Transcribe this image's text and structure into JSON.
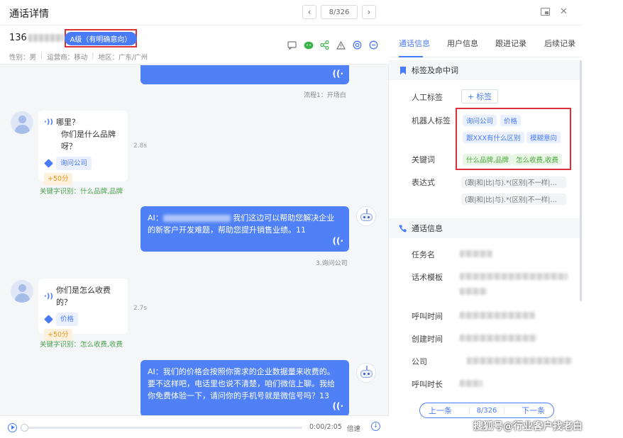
{
  "window": {
    "title": "通话详情",
    "page_indicator": "8/326",
    "prev_icon": "chevron-left-icon",
    "next_icon": "chevron-right-icon"
  },
  "caller": {
    "phone_prefix": "136",
    "level_badge": "A级（有明确意向）",
    "gender": "性别：男",
    "carrier": "运营商：移动",
    "region": "地区：广东/广州"
  },
  "chat": {
    "ai_msg_1": {
      "node": "流程1：开场白"
    },
    "user_msg_1": {
      "text1": "哪里？",
      "text2": "你们是什么品牌呀？",
      "tag": "询问公司",
      "score": "+50分",
      "duration": "2.8s",
      "keyword_hit": "关键字识别：什么品牌,品牌"
    },
    "ai_msg_2": {
      "prefix": "AI：",
      "text": "我们这边可以帮助您解决企业的新客户开发难题，帮助您提升销售业绩。11",
      "node": "3.询问公司"
    },
    "user_msg_2": {
      "text1": "你们是怎么收费的？",
      "tag": "价格",
      "score": "+50分",
      "duration": "2.7s",
      "keyword_hit": "关键字识别：怎么收费,收费"
    },
    "ai_msg_3": {
      "text": "AI：我们的价格会按照你需求的企业数据量来收费的。要不这样吧，电话里也说不清楚，咱们微信上聊。我给你免费体验一下，请问你的手机号就是微信号吗？13"
    }
  },
  "player": {
    "time": "0:00/2:05",
    "speed": "倍速"
  },
  "tabs": [
    "通话信息",
    "用户信息",
    "跟进记录",
    "后续记录"
  ],
  "tags_section": {
    "title": "标签及命中词",
    "manual_label": "人工标签",
    "add_tag": "标签",
    "robot_label": "机器人标签",
    "robot_tags": [
      "询问公司",
      "价格",
      "跟XXX有什么区别",
      "模糊意向"
    ],
    "keyword_label": "关键词",
    "keywords": [
      "什么品牌,品牌",
      "怎么收费,收费"
    ],
    "expr_label": "表达式",
    "expressions": [
      "(跟|和|比|与).*(区别|不一样|一样|...",
      "(跟|和|比|与).*(区别|不一样|一样|..."
    ]
  },
  "call_section": {
    "title": "通话信息",
    "fields": [
      "任务名",
      "话术模板",
      "呼叫时间",
      "创建时间",
      "公司",
      "呼叫时长"
    ]
  },
  "bottom_pager": {
    "prev": "上一条",
    "indicator": "8/326",
    "next": "下一条"
  },
  "watermark": "搜狐号@行业客户找老白",
  "colors": {
    "accent": "#4a7bf7",
    "highlight_box": "#d9303a",
    "keyword_green": "#49a83a"
  }
}
